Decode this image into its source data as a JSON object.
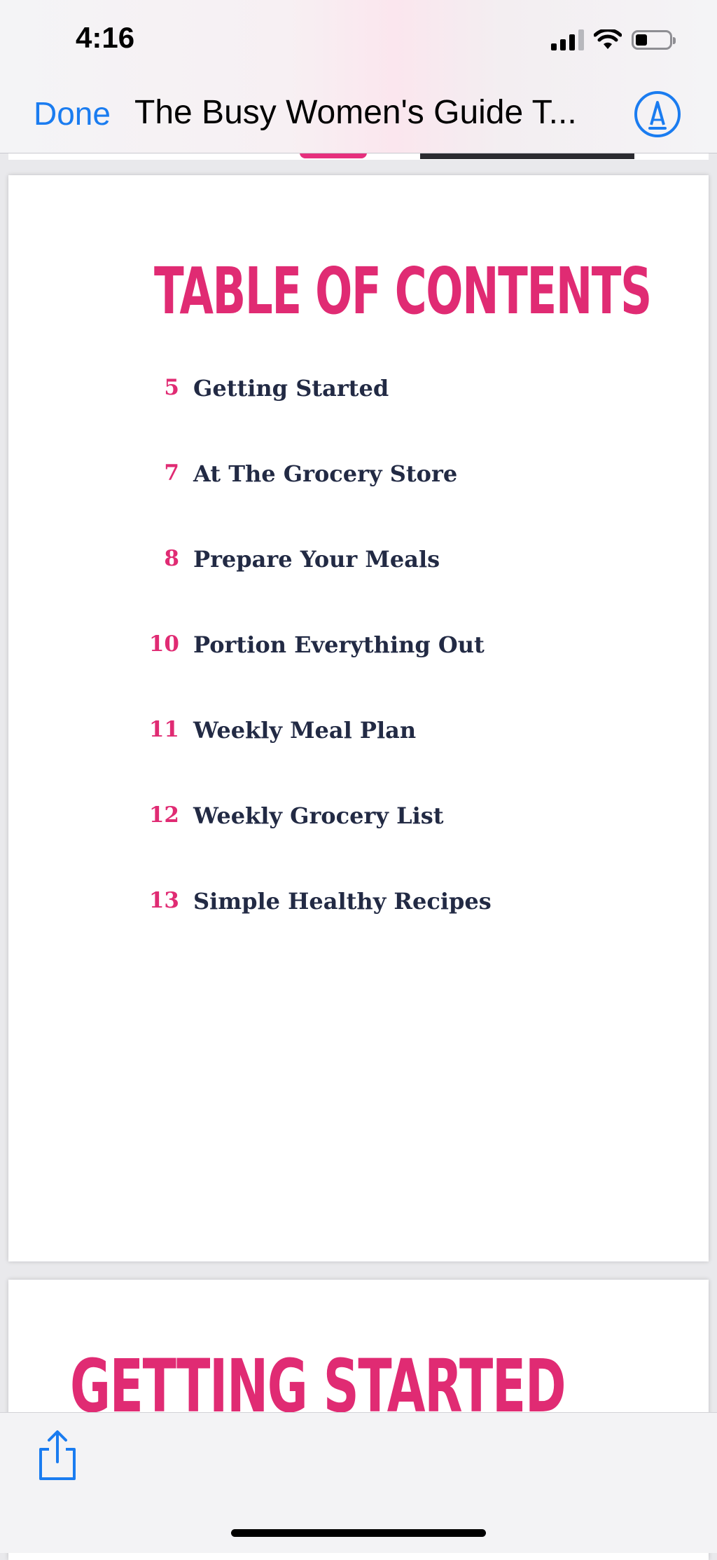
{
  "status_bar": {
    "time": "4:16"
  },
  "nav": {
    "done_label": "Done",
    "title": "The Busy Women's Guide T..."
  },
  "toc": {
    "heading": "TABLE OF CONTENTS",
    "items": [
      {
        "page": "5",
        "label": "Getting Started"
      },
      {
        "page": "7",
        "label": "At The Grocery Store"
      },
      {
        "page": "8",
        "label": "Prepare Your Meals"
      },
      {
        "page": "10",
        "label": "Portion Everything Out"
      },
      {
        "page": "11",
        "label": "Weekly Meal Plan"
      },
      {
        "page": "12",
        "label": "Weekly Grocery List"
      },
      {
        "page": "13",
        "label": "Simple Healthy Recipes"
      }
    ]
  },
  "next_page": {
    "heading": "GETTING STARTED"
  },
  "icons": {
    "markup": "markup-pen-icon",
    "share": "share-icon",
    "signal": "cellular-signal-icon",
    "wifi": "wifi-icon",
    "battery": "battery-icon"
  },
  "colors": {
    "accent": "#e02b73",
    "link": "#1a7cf0",
    "text": "#222a44"
  }
}
